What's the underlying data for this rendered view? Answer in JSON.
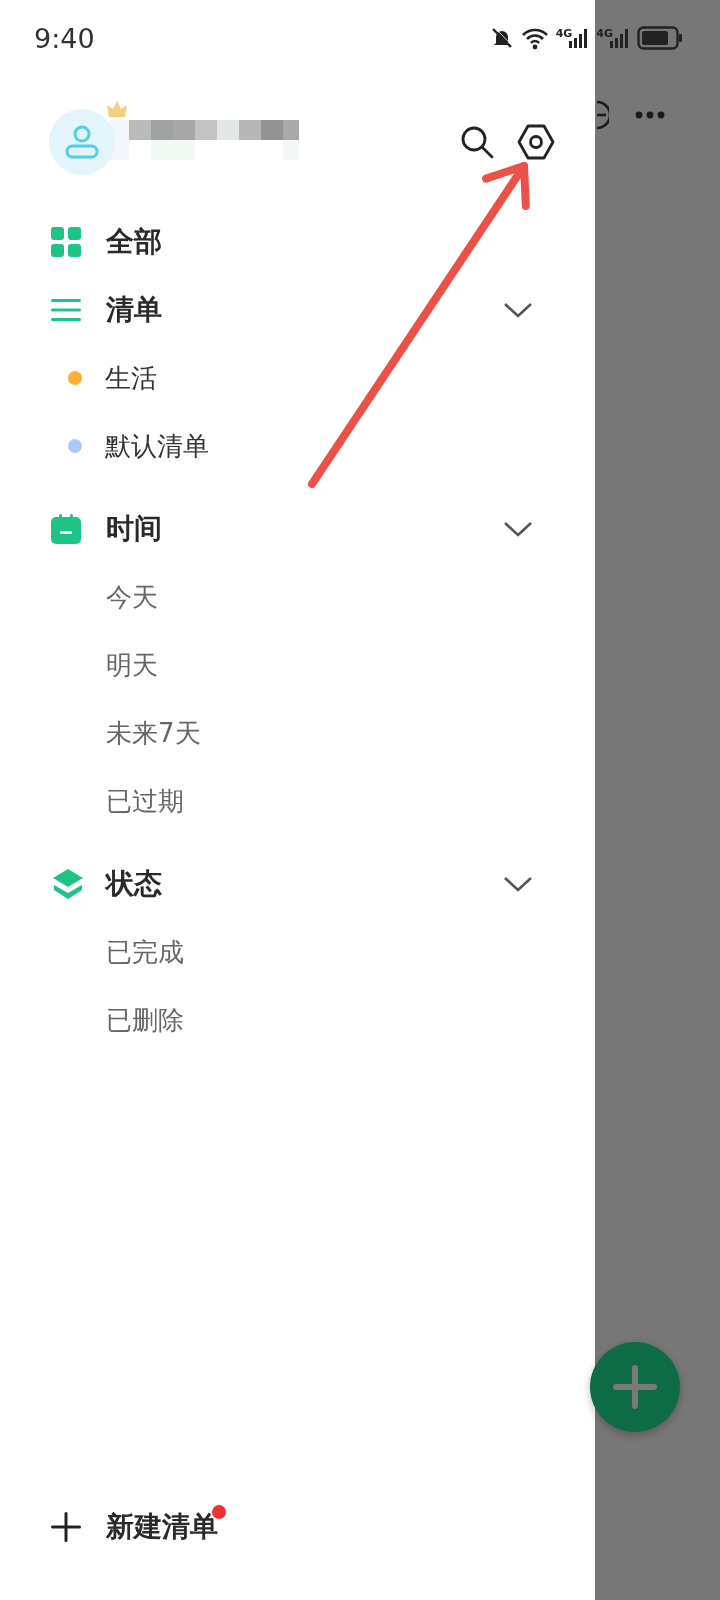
{
  "status_bar": {
    "time": "9:40",
    "network_labels": [
      "4G",
      "4G"
    ]
  },
  "drawer": {
    "profile": {
      "vip": true
    },
    "sections": [
      {
        "kind": "all",
        "label": "全部"
      },
      {
        "kind": "lists",
        "label": "清单",
        "expanded": true,
        "children": [
          {
            "label": "生活",
            "color": "#fbb12f"
          },
          {
            "label": "默认清单",
            "color": "#a9c9f6"
          }
        ]
      },
      {
        "kind": "time",
        "label": "时间",
        "expanded": true,
        "children": [
          {
            "label": "今天"
          },
          {
            "label": "明天"
          },
          {
            "label": "未来7天"
          },
          {
            "label": "已过期"
          }
        ]
      },
      {
        "kind": "status",
        "label": "状态",
        "expanded": true,
        "children": [
          {
            "label": "已完成"
          },
          {
            "label": "已删除"
          }
        ]
      }
    ],
    "new_list": {
      "label": "新建清单",
      "has_notification": true
    }
  },
  "annotation": {
    "kind": "arrow"
  }
}
